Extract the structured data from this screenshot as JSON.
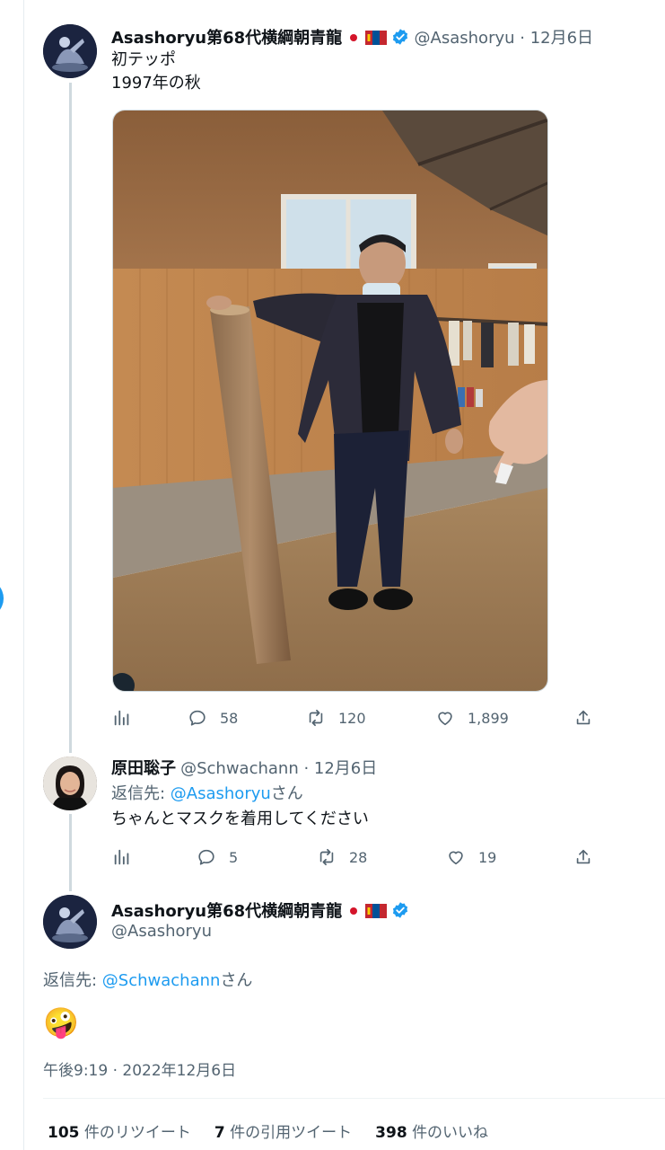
{
  "tweet1": {
    "author_name": "Asashoryu第68代横綱朝青龍",
    "handle_date": "@Asashoryu · 12月6日",
    "line1": "初テッポ",
    "line2": "1997年の秋",
    "replies": "58",
    "retweets": "120",
    "likes": "1,899"
  },
  "tweet2": {
    "author_name": "原田聡子",
    "handle_date": "@Schwachann · 12月6日",
    "reply_prefix": "返信先: ",
    "reply_to": "@Asashoryu",
    "reply_suffix": "さん",
    "text": "ちゃんとマスクを着用してください",
    "replies": "5",
    "retweets": "28",
    "likes": "19"
  },
  "tweet3": {
    "author_name": "Asashoryu第68代横綱朝青龍",
    "handle": "@Asashoryu",
    "reply_prefix": "返信先: ",
    "reply_to": "@Schwachann",
    "reply_suffix": "さん",
    "emoji": "🤪",
    "timestamp": "午後9:19 · 2022年12月6日"
  },
  "stats": {
    "retweets_count": "105",
    "retweets_label": "件のリツイート",
    "quotes_count": "7",
    "quotes_label": "件の引用ツイート",
    "likes_count": "398",
    "likes_label": "件のいいね"
  },
  "colors": {
    "accent": "#1d9bf0",
    "muted": "#536471",
    "text": "#0f1419"
  },
  "icons": [
    "views-icon",
    "reply-icon",
    "retweet-icon",
    "like-icon",
    "share-icon",
    "verified-icon",
    "japan-flag-icon",
    "mongolia-flag-icon"
  ]
}
